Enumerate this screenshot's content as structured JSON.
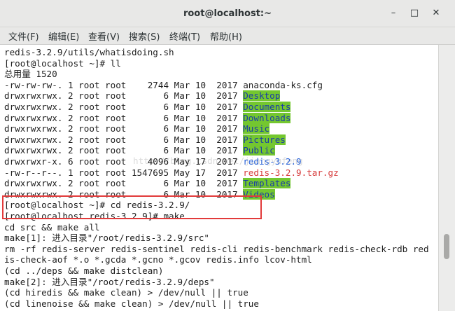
{
  "window": {
    "title": "root@localhost:~",
    "controls": {
      "minimize": "–",
      "maximize": "□",
      "close": "✕"
    }
  },
  "menu": [
    "文件(F)",
    "编辑(E)",
    "查看(V)",
    "搜索(S)",
    "终端(T)",
    "帮助(H)"
  ],
  "terminal": {
    "lines": [
      "redis-3.2.9/utils/whatisdoing.sh",
      "[root@localhost ~]# ll",
      "总用量 1520",
      "-rw-rw-rw-. 1 root root    2744 Mar 10  2017 ",
      "drwxrwxrwx. 2 root root       6 Mar 10  2017 ",
      "drwxrwxrwx. 2 root root       6 Mar 10  2017 ",
      "drwxrwxrwx. 2 root root       6 Mar 10  2017 ",
      "drwxrwxrwx. 2 root root       6 Mar 10  2017 ",
      "drwxrwxrwx. 2 root root       6 Mar 10  2017 ",
      "drwxrwxrwx. 2 root root       6 Mar 10  2017 ",
      "drwxrwxr-x. 6 root root    4096 May 17  2017 ",
      "-rw-r--r--. 1 root root 1547695 May 17  2017 ",
      "drwxrwxrwx. 2 root root       6 Mar 10  2017 ",
      "drwxrwxrwx. 2 root root       6 Mar 10  2017 ",
      "[root@localhost ~]# cd redis-3.2.9/",
      "[root@localhost redis-3.2.9]# make",
      "cd src && make all",
      "make[1]: 进入目录\"/root/redis-3.2.9/src\"",
      "rm -rf redis-server redis-sentinel redis-cli redis-benchmark redis-check-rdb red",
      "is-check-aof *.o *.gcda *.gcno *.gcov redis.info lcov-html",
      "(cd ../deps && make distclean)",
      "make[2]: 进入目录\"/root/redis-3.2.9/deps\"",
      "(cd hiredis && make clean) > /dev/null || true",
      "(cd linenoise && make clean) > /dev/null || true"
    ],
    "names": [
      null,
      null,
      null,
      "anaconda-ks.cfg",
      "Desktop",
      "Documents",
      "Downloads",
      "Music",
      "Pictures",
      "Public",
      "redis-3.2.9",
      "redis-3.2.9.tar.gz",
      "Templates",
      "Videos"
    ],
    "watermark": "http://blog.csdn.net/jiangyufeng"
  },
  "colors": {
    "dir_bg": "#74c72f",
    "dir_fg": "#1a3ca8",
    "link": "#2b64d8",
    "archive": "#d63b3b",
    "highlight": "#e23b3b"
  }
}
